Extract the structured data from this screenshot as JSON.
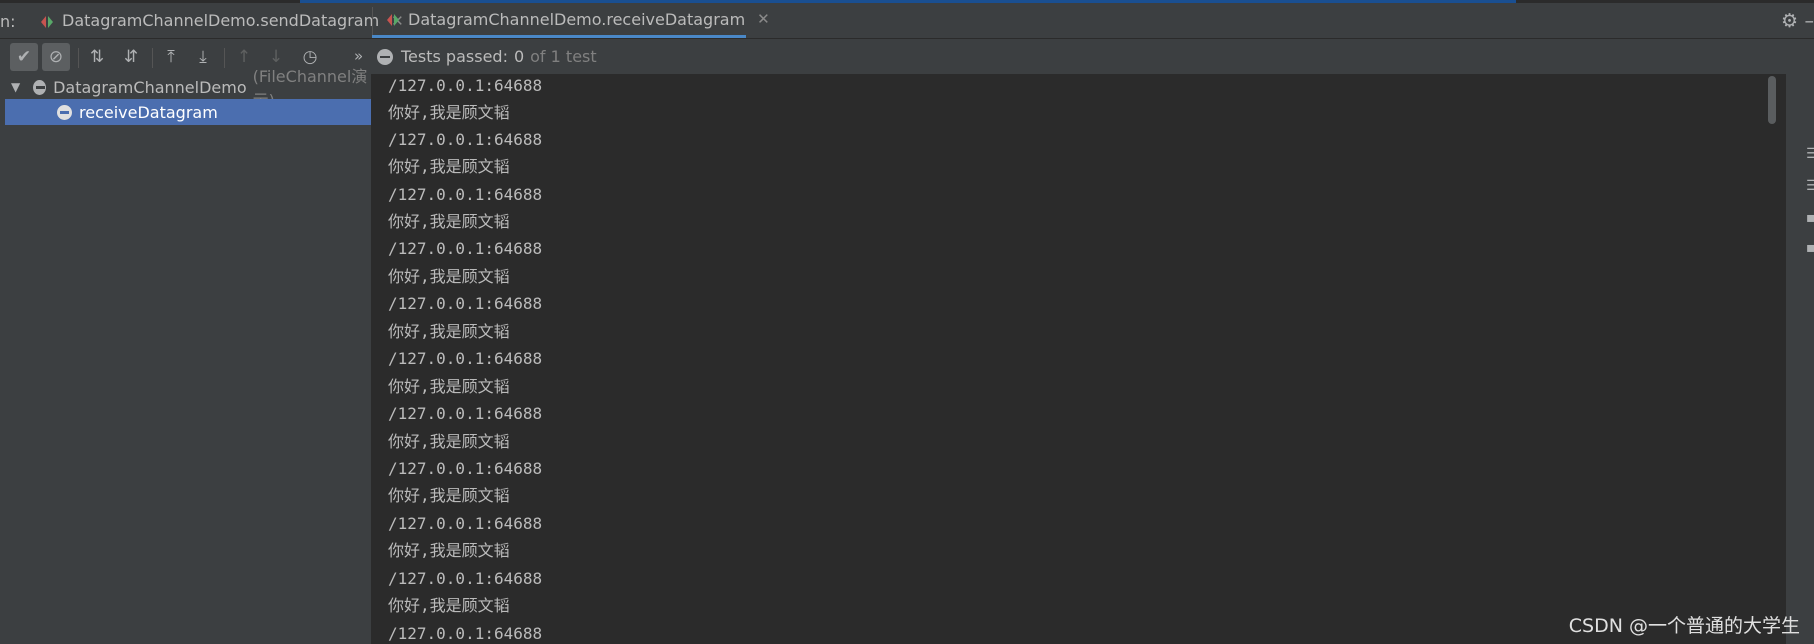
{
  "tabs": {
    "run_label": "n:",
    "send_label": "DatagramChannelDemo.sendDatagram",
    "receive_label": "DatagramChannelDemo.receiveDatagram",
    "close_glyph": "✕"
  },
  "toolbar": {
    "buttons": [
      {
        "name": "show-passed-icon",
        "glyph": "✔"
      },
      {
        "name": "show-ignored-icon",
        "glyph": "⊘"
      },
      {
        "name": "sort-alpha-icon",
        "glyph": "⇅"
      },
      {
        "name": "sort-duration-icon",
        "glyph": "⇵"
      },
      {
        "name": "expand-all-icon",
        "glyph": "⤒"
      },
      {
        "name": "collapse-all-icon",
        "glyph": "⤓"
      },
      {
        "name": "previous-failed-icon",
        "glyph": "↑"
      },
      {
        "name": "next-failed-icon",
        "glyph": "↓"
      },
      {
        "name": "test-history-icon",
        "glyph": "◷"
      }
    ],
    "overflow_glyph": "»"
  },
  "status": {
    "label": "Tests passed:",
    "count": "0",
    "of_text": "of 1 test"
  },
  "tree": {
    "root_name": "DatagramChannelDemo",
    "root_hint": "(FileChannel演示)",
    "child_name": "receiveDatagram"
  },
  "console": {
    "lines": [
      "/127.0.0.1:64688",
      "你好,我是顾文韬",
      "/127.0.0.1:64688",
      "你好,我是顾文韬",
      "/127.0.0.1:64688",
      "你好,我是顾文韬",
      "/127.0.0.1:64688",
      "你好,我是顾文韬",
      "/127.0.0.1:64688",
      "你好,我是顾文韬",
      "/127.0.0.1:64688",
      "你好,我是顾文韬",
      "/127.0.0.1:64688",
      "你好,我是顾文韬",
      "/127.0.0.1:64688",
      "你好,我是顾文韬",
      "/127.0.0.1:64688",
      "你好,我是顾文韬",
      "/127.0.0.1:64688",
      "你好,我是顾文韬",
      "/127.0.0.1:64688"
    ]
  },
  "watermark": "CSDN @一个普通的大学生",
  "colors": {
    "accent": "#4a88c7",
    "selection": "#4b6eaf",
    "panel": "#3c3f41",
    "editor": "#2b2b2b"
  }
}
